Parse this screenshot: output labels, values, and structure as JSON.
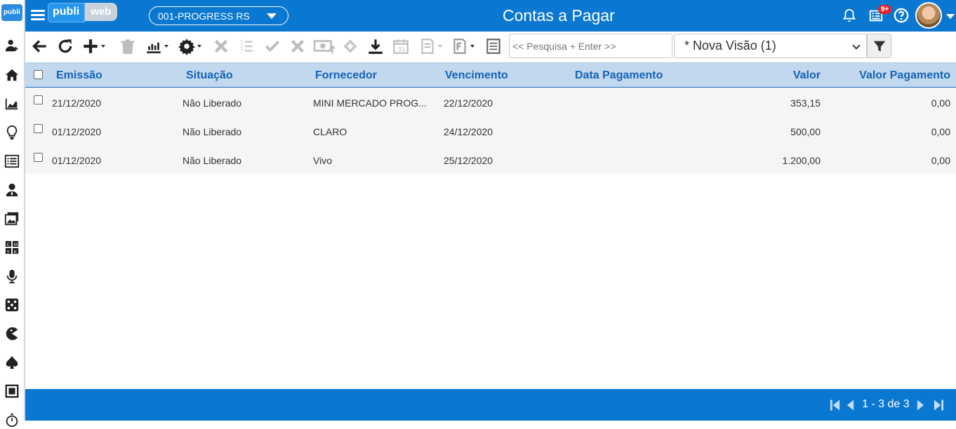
{
  "app": {
    "brand_part1": "publi",
    "brand_part2": "web",
    "sidebar_logo": "publi",
    "company": "001-PROGRESS RS",
    "page_title": "Contas a Pagar",
    "notification_badge": "9+",
    "accent_color": "#0a78d1"
  },
  "sidebar": {
    "icons": [
      "add-user-icon",
      "home-icon",
      "area-chart-icon",
      "lightbulb-icon",
      "list-icon",
      "user-tie-icon",
      "images-icon",
      "cmyk-icon",
      "microphone-icon",
      "dice-icon",
      "pacman-icon",
      "spade-icon",
      "square-icon",
      "stopwatch-icon"
    ]
  },
  "toolbar": {
    "search_placeholder": "<< Pesquisa + Enter >>",
    "view_select": "* Nova Visão (1)"
  },
  "table": {
    "columns": [
      "Emissão",
      "Situação",
      "Fornecedor",
      "Vencimento",
      "Data Pagamento",
      "Valor",
      "Valor Pagamento"
    ],
    "rows": [
      {
        "emissao": "21/12/2020",
        "situacao": "Não Liberado",
        "fornecedor": "MINI MERCADO PROG...",
        "vencimento": "22/12/2020",
        "data_pagamento": "",
        "valor": "353,15",
        "valor_pagamento": "0,00"
      },
      {
        "emissao": "01/12/2020",
        "situacao": "Não Liberado",
        "fornecedor": "CLARO",
        "vencimento": "24/12/2020",
        "data_pagamento": "",
        "valor": "500,00",
        "valor_pagamento": "0,00"
      },
      {
        "emissao": "01/12/2020",
        "situacao": "Não Liberado",
        "fornecedor": "Vivo",
        "vencimento": "25/12/2020",
        "data_pagamento": "",
        "valor": "1.200,00",
        "valor_pagamento": "0,00"
      }
    ]
  },
  "pagination": {
    "text": "1 - 3 de 3"
  }
}
